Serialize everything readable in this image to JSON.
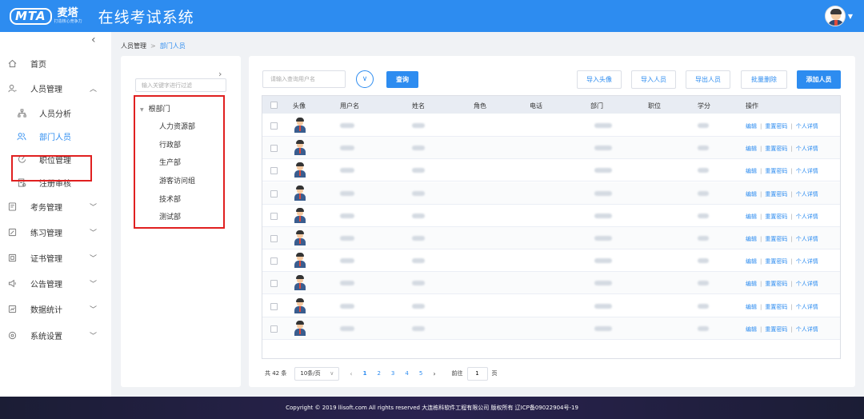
{
  "header": {
    "logo_text": "MTA",
    "brand_name": "麦塔",
    "slogan": "打造核心竞争力",
    "app_title": "在线考试系统"
  },
  "sidebar": {
    "items": [
      {
        "label": "首页",
        "icon": "home-icon"
      },
      {
        "label": "人员管理",
        "icon": "user-icon",
        "expanded": true
      },
      {
        "label": "人员分析",
        "icon": "org-chart-icon",
        "sub": true
      },
      {
        "label": "部门人员",
        "icon": "users-icon",
        "sub": true,
        "active": true
      },
      {
        "label": "职位管理",
        "icon": "position-icon",
        "sub": true
      },
      {
        "label": "注册审核",
        "icon": "audit-icon",
        "sub": true
      },
      {
        "label": "考务管理",
        "icon": "exam-icon"
      },
      {
        "label": "练习管理",
        "icon": "practice-icon"
      },
      {
        "label": "证书管理",
        "icon": "certificate-icon"
      },
      {
        "label": "公告管理",
        "icon": "announcement-icon"
      },
      {
        "label": "数据统计",
        "icon": "statistics-icon"
      },
      {
        "label": "系统设置",
        "icon": "settings-icon"
      }
    ]
  },
  "breadcrumb": {
    "parent": "人员管理",
    "separator": ">",
    "current": "部门人员"
  },
  "tree": {
    "filter_placeholder": "输入关键字进行过滤",
    "root": "根部门",
    "children": [
      "人力资源部",
      "行政部",
      "生产部",
      "游客访问组",
      "技术部",
      "测试部"
    ]
  },
  "toolbar": {
    "search_placeholder": "请输入查询用户名",
    "query_label": "查询",
    "import_avatar": "导入头像",
    "import_users": "导入人员",
    "export_users": "导出人员",
    "batch_delete": "批量删除",
    "add_user": "添加人员"
  },
  "table": {
    "columns": [
      "头像",
      "用户名",
      "姓名",
      "角色",
      "电话",
      "部门",
      "职位",
      "学分",
      "操作"
    ],
    "row_count_visible": 10,
    "actions": {
      "edit": "编辑",
      "reset_password": "重置密码",
      "details": "个人详情",
      "separator": "|"
    }
  },
  "pagination": {
    "total_label": "共 42 条",
    "page_size": "10条/页",
    "pages": [
      "1",
      "2",
      "3",
      "4",
      "5"
    ],
    "current_page": "1",
    "goto_prefix": "前往",
    "goto_value": "1",
    "goto_suffix": "页"
  },
  "footer": {
    "copyright": "Copyright © 2019 llisoft.com All rights reserved 大连栋科软件工程有限公司 版权所有 辽ICP备09022904号-19"
  },
  "colors": {
    "primary": "#2d8cf0",
    "highlight_box": "#e02020",
    "footer": "#1f1f3a"
  }
}
